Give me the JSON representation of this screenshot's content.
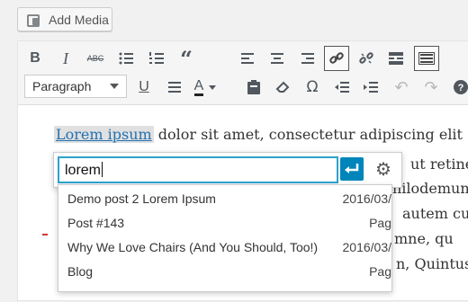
{
  "top": {
    "add_media_label": "Add Media"
  },
  "toolbar": {
    "format_value": "Paragraph"
  },
  "content": {
    "link_text": "Lorem ipsum",
    "line1_rest": " dolor sit amet, consectetur adipiscing elit",
    "line2_right": "ut retiner",
    "line3_right": "nilodemun",
    "line4_right": "autem cu",
    "line5_right": "mne, qu",
    "line6_right": "n, Quintus"
  },
  "link_popup": {
    "input_value": "lorem"
  },
  "results": [
    {
      "title": "Demo post 2 Lorem Ipsum",
      "meta": "2016/03/"
    },
    {
      "title": "Post #143",
      "meta": "Pag"
    },
    {
      "title": "Why We Love Chairs (And You Should, Too!)",
      "meta": "2016/03/"
    },
    {
      "title": "Blog",
      "meta": "Pag"
    }
  ],
  "colors": {
    "accent": "#0085ba",
    "focus": "#2ea2cc",
    "link": "#2271b1"
  }
}
